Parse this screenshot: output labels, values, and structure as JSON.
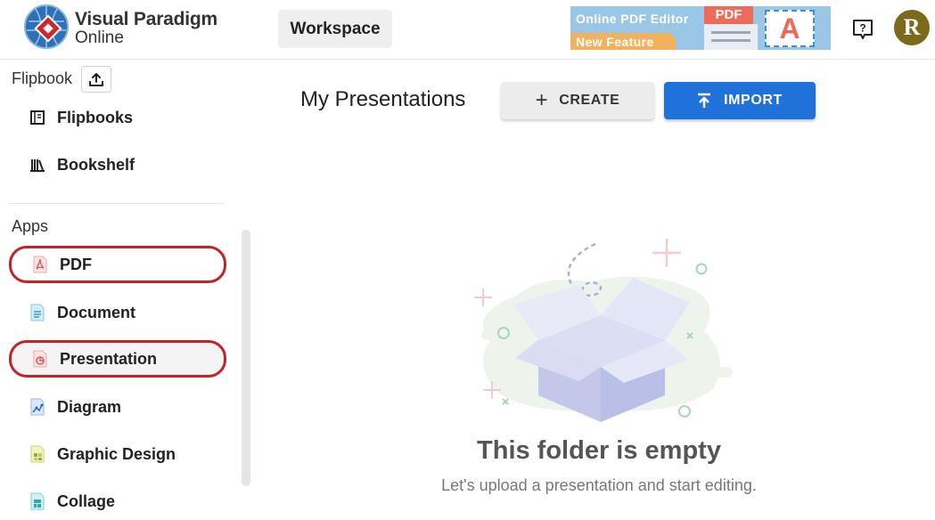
{
  "header": {
    "logo_title": "Visual Paradigm",
    "logo_subtitle": "Online",
    "workspace_label": "Workspace",
    "banner": {
      "line1": "Online PDF Editor",
      "line2": "New Feature",
      "pdf_tag": "PDF",
      "letter": "A"
    },
    "avatar_initial": "R"
  },
  "sidebar": {
    "flipbook_section": "Flipbook",
    "flipbook_items": [
      {
        "label": "Flipbooks",
        "icon": "flipbook-icon"
      },
      {
        "label": "Bookshelf",
        "icon": "bookshelf-icon"
      }
    ],
    "apps_section": "Apps",
    "app_items": [
      {
        "label": "PDF",
        "icon": "pdf-icon"
      },
      {
        "label": "Document",
        "icon": "document-icon"
      },
      {
        "label": "Presentation",
        "icon": "presentation-icon"
      },
      {
        "label": "Diagram",
        "icon": "diagram-icon"
      },
      {
        "label": "Graphic Design",
        "icon": "graphic-design-icon"
      },
      {
        "label": "Collage",
        "icon": "collage-icon"
      }
    ]
  },
  "main": {
    "title": "My Presentations",
    "create_label": "CREATE",
    "import_label": "IMPORT",
    "empty_title": "This folder is empty",
    "empty_subtitle": "Let's upload a presentation and start editing."
  },
  "colors": {
    "accent": "#1f72d9",
    "highlight_ring": "#c0242a",
    "avatar": "#7b6a1c"
  }
}
